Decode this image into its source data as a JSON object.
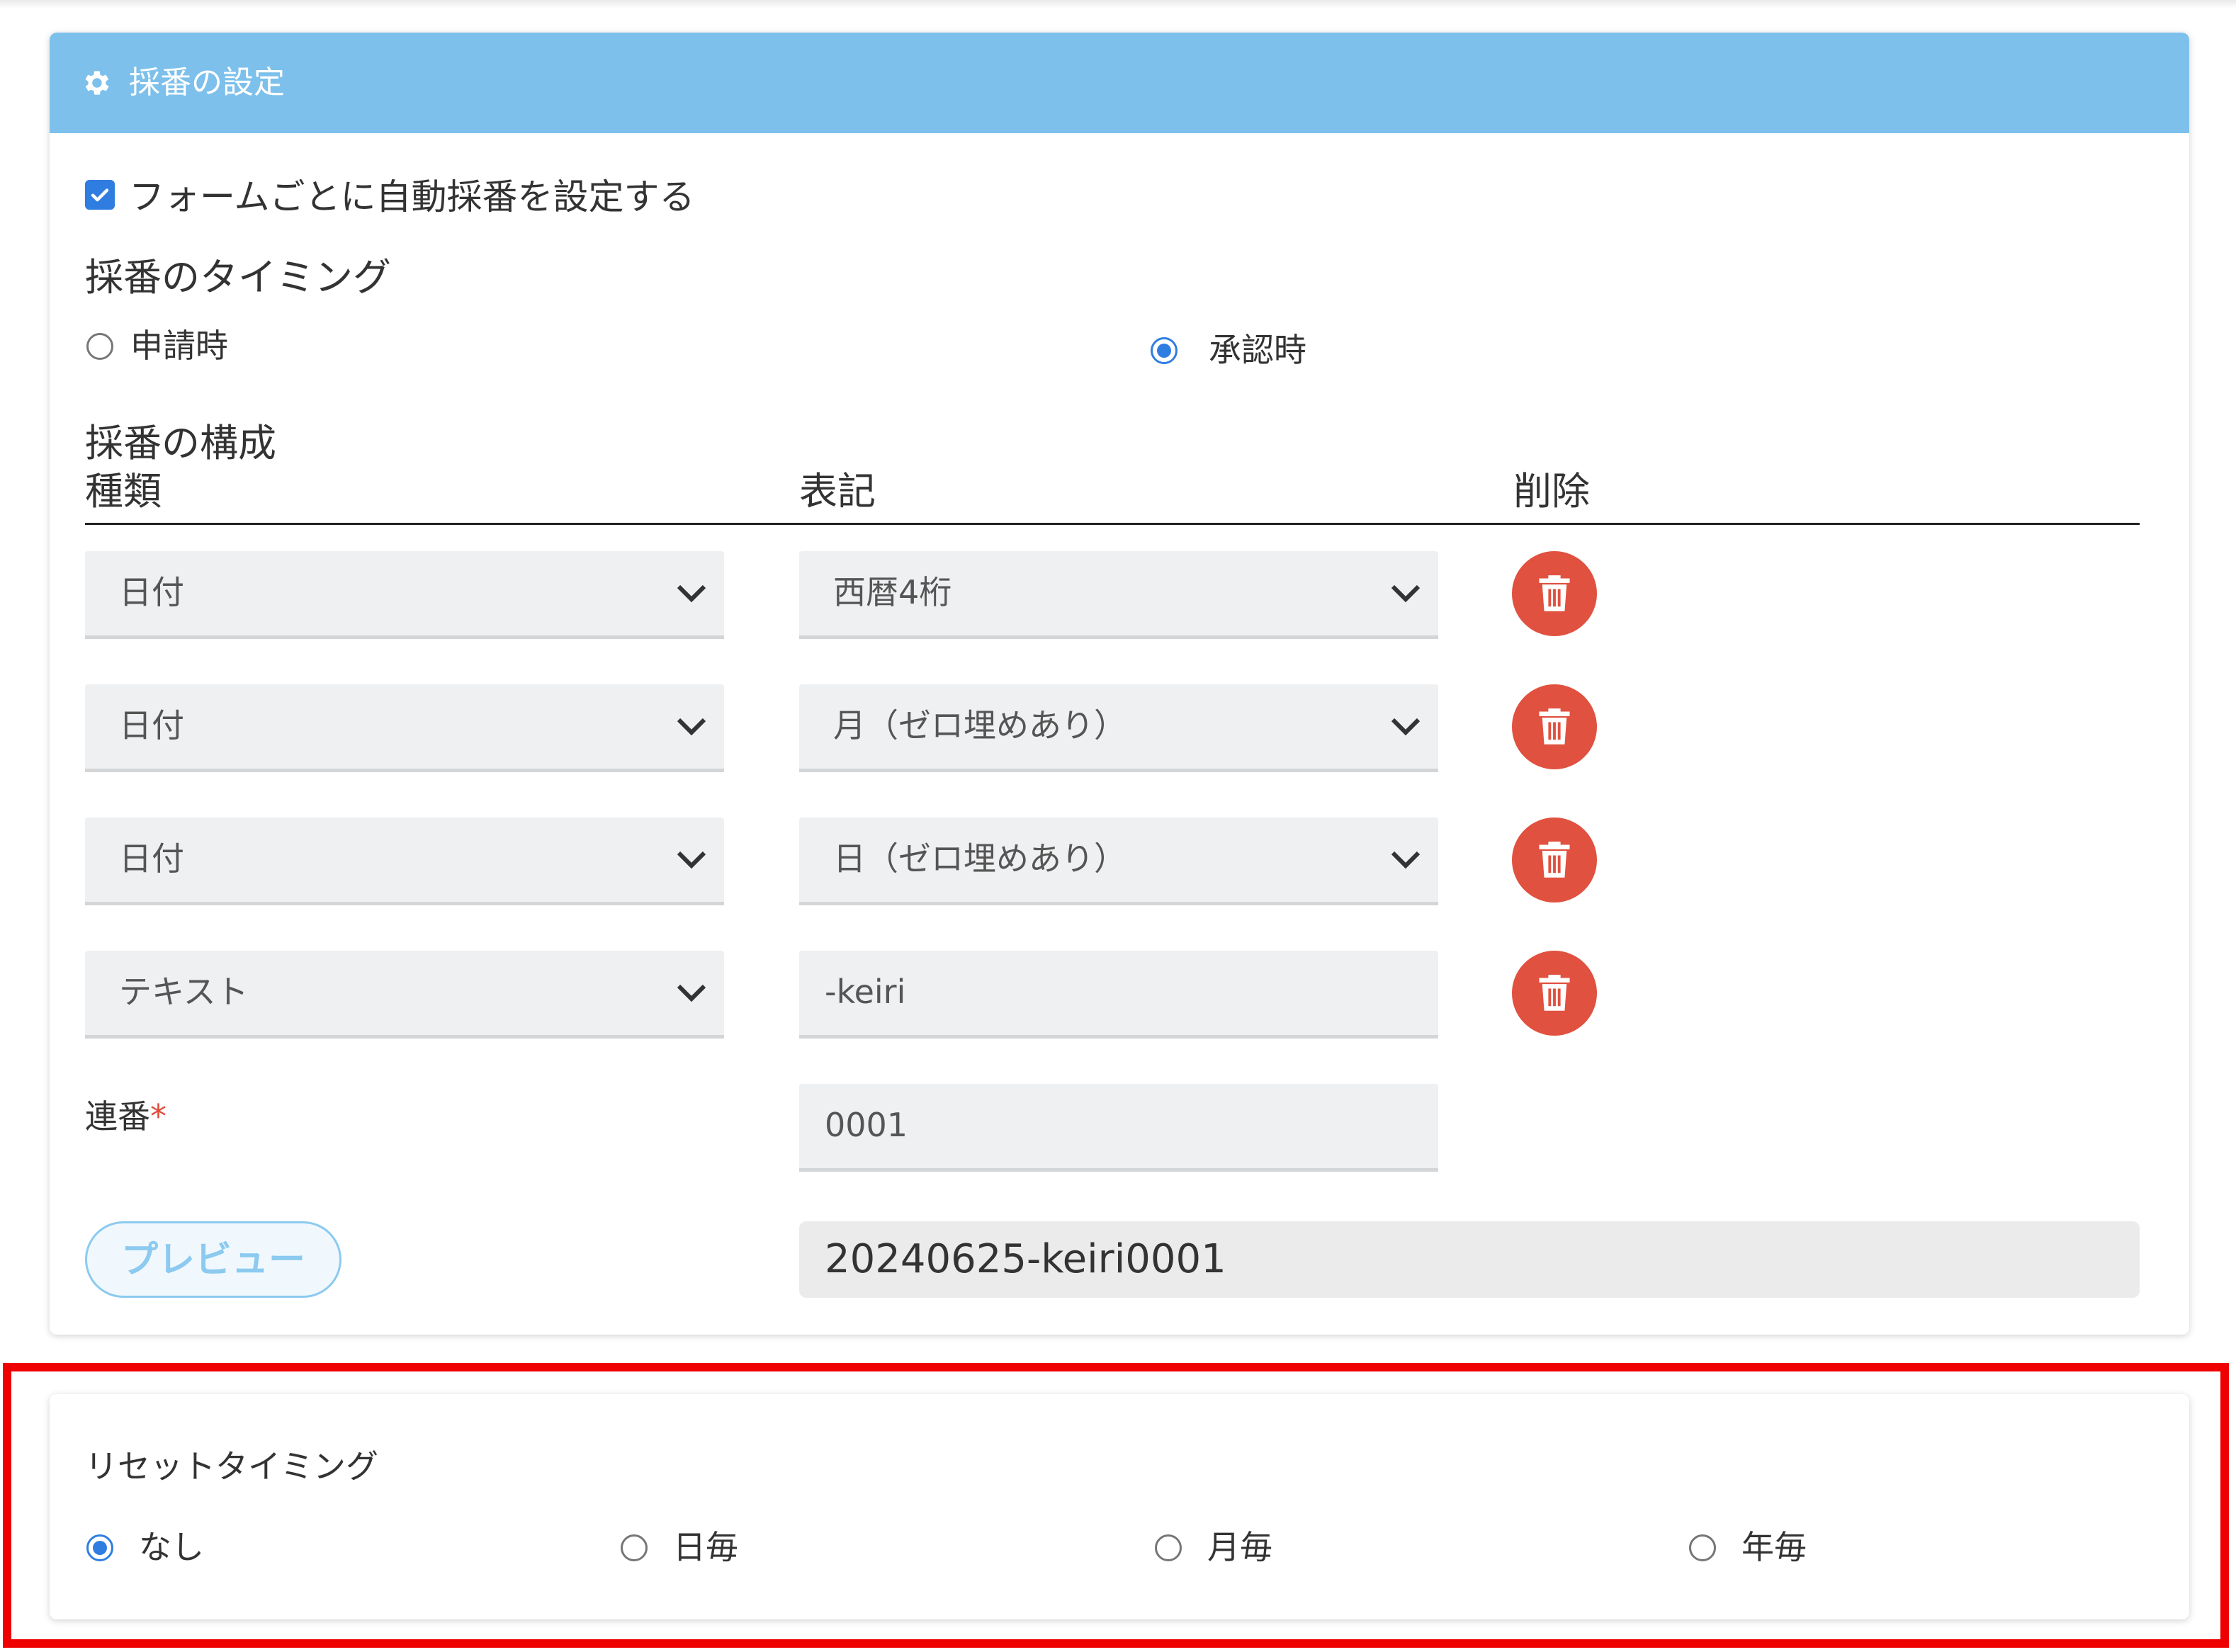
{
  "header": {
    "title": "採番の設定",
    "icon": "gear-icon"
  },
  "auto_numbering": {
    "checkbox_label": "フォームごとに自動採番を設定する",
    "checked": true
  },
  "timing": {
    "title": "採番のタイミング",
    "options": [
      {
        "label": "申請時",
        "selected": false
      },
      {
        "label": "承認時",
        "selected": true
      }
    ]
  },
  "composition": {
    "title": "採番の構成",
    "columns": {
      "type": "種類",
      "notation": "表記",
      "delete": "削除"
    },
    "rows": [
      {
        "type": "日付",
        "notation": "西暦4桁"
      },
      {
        "type": "日付",
        "notation": "月（ゼロ埋めあり）"
      },
      {
        "type": "日付",
        "notation": "日（ゼロ埋めあり）"
      },
      {
        "type": "テキスト",
        "notation": "-keiri"
      }
    ],
    "serial": {
      "label": "連番",
      "required_mark": "*",
      "value": "0001"
    },
    "preview": {
      "button_label": "プレビュー",
      "value": "20240625-keiri0001"
    }
  },
  "reset": {
    "title": "リセットタイミング",
    "options": [
      {
        "label": "なし",
        "selected": true
      },
      {
        "label": "日毎",
        "selected": false
      },
      {
        "label": "月毎",
        "selected": false
      },
      {
        "label": "年毎",
        "selected": false
      }
    ]
  },
  "colors": {
    "header_bg": "#7dc0eb",
    "accent_blue": "#2f7de1",
    "delete_red": "#e0513f",
    "highlight_frame": "#ee0000"
  }
}
